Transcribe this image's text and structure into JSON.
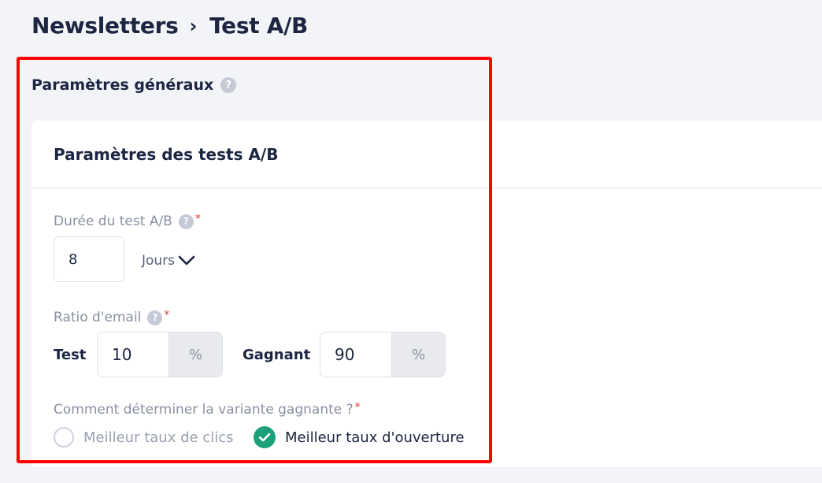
{
  "breadcrumb": {
    "parent": "Newsletters",
    "separator": "›",
    "current": "Test A/B"
  },
  "section": {
    "title": "Paramètres généraux",
    "help_icon": "?"
  },
  "card": {
    "title": "Paramètres des tests A/B"
  },
  "duration": {
    "label": "Durée du test A/B",
    "required_mark": "*",
    "value": "8",
    "unit": "Jours"
  },
  "ratio": {
    "label": "Ratio d'email",
    "required_mark": "*",
    "test_label": "Test",
    "test_value": "10",
    "test_unit": "%",
    "winner_label": "Gagnant",
    "winner_value": "90",
    "winner_unit": "%"
  },
  "winner_method": {
    "label": "Comment déterminer la variante gagnante ?",
    "required_mark": "*",
    "options": [
      {
        "label": "Meilleur taux de clics",
        "selected": false
      },
      {
        "label": "Meilleur taux d'ouverture",
        "selected": true
      }
    ]
  },
  "colors": {
    "accent_green": "#1ba17a",
    "highlight_red": "#ff0000",
    "title_navy": "#1c2541",
    "background": "#f3f4f8"
  }
}
